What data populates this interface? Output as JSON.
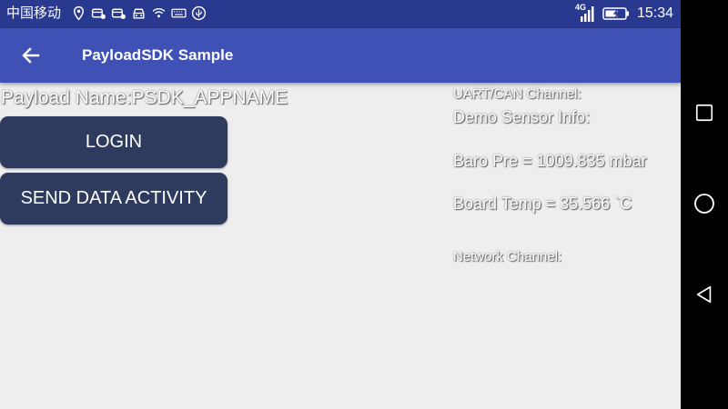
{
  "status_bar": {
    "carrier": "中国移动",
    "network_type": "4G",
    "time": "15:34",
    "icons": [
      "location-icon",
      "car-icon",
      "car-icon",
      "car-icon",
      "wifi-icon",
      "keyboard-icon",
      "usb-icon",
      "signal-icon",
      "battery-charging-icon"
    ]
  },
  "app_bar": {
    "title": "PayloadSDK Sample",
    "back_icon": "arrow-left-icon"
  },
  "main": {
    "payload_name": "Payload Name:PSDK_APPNAME",
    "login_label": "LOGIN",
    "send_data_label": "SEND DATA ACTIVITY",
    "uart_channel": "UART/CAN Channel:",
    "demo_sensor_info": "Demo Sensor Info:",
    "baro_pressure": "Baro Pre = 1009.835 mbar",
    "board_temp": "Board Temp = 35.566 `C",
    "network_channel": "Network Channel:"
  },
  "nav_bar": {
    "recent_icon": "square-icon",
    "home_icon": "circle-icon",
    "back_icon": "triangle-back-icon"
  },
  "colors": {
    "status_bar": "#2a3990",
    "app_bar": "#3f51b5",
    "button": "#2e3a5e",
    "background": "#eeeeee"
  }
}
